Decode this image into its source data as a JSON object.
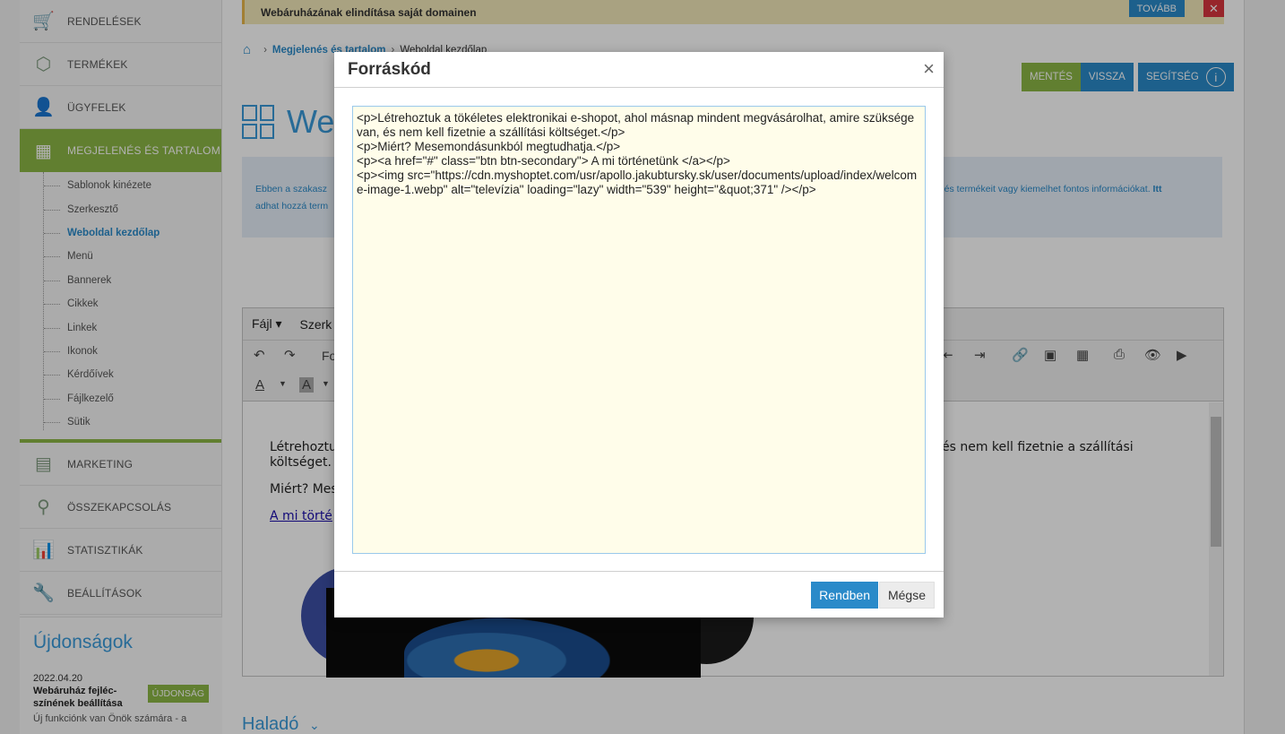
{
  "sidebar": {
    "items": [
      {
        "label": "RENDELÉSEK",
        "icon": "cart-icon"
      },
      {
        "label": "TERMÉKEK",
        "icon": "box-icon"
      },
      {
        "label": "ÜGYFELEK",
        "icon": "user-icon"
      },
      {
        "label": "MEGJELENÉS ÉS TARTALOM",
        "icon": "layout-icon"
      }
    ],
    "subitems": [
      "Sablonok kinézete",
      "Szerkesztő",
      "Weboldal kezdőlap",
      "Menü",
      "Bannerek",
      "Cikkek",
      "Linkek",
      "Ikonok",
      "Kérdőívek",
      "Fájlkezelő",
      "Sütik"
    ],
    "items_bottom": [
      {
        "label": "MARKETING",
        "icon": "megaphone-icon"
      },
      {
        "label": "ÖSSZEKAPCSOLÁS",
        "icon": "plug-icon"
      },
      {
        "label": "STATISZTIKÁK",
        "icon": "stats-icon"
      },
      {
        "label": "BEÁLLÍTÁSOK",
        "icon": "wrench-icon"
      }
    ]
  },
  "news": {
    "title": "Újdonságok",
    "date": "2022.04.20",
    "headline": "Webáruház fejléc-színének beállítása",
    "badge": "ÚJDONSÁG",
    "text": "Új funkciónk van Önök számára - a"
  },
  "notice": {
    "text": "Webáruházának elindítása saját domainen",
    "more": "TOVÁBB",
    "close": "✕"
  },
  "breadcrumb": {
    "link": "Megjelenés és tartalom",
    "current": "Weboldal kezdőlap"
  },
  "actions": {
    "save": "MENTÉS",
    "back": "VISSZA",
    "help": "SEGÍTSÉG"
  },
  "page": {
    "title_partial": "We",
    "info_left": "Ebben a szakasz",
    "info_left2": "adhat hozzá term",
    "info_right": "át és termékeit vagy kiemelhet fontos információkat.",
    "info_right_bold": "Itt"
  },
  "editor": {
    "menu": [
      "Fájl ▾",
      "Szerk"
    ],
    "format_partial": "Fo",
    "body_p1_left": "Létrehoztu",
    "body_p1_right": "és nem kell fizetnie a szállítási",
    "body_p1_line2": "költséget.",
    "body_p2": "Miért? Mes",
    "body_link": "A mi törté"
  },
  "advanced": {
    "label": "Haladó"
  },
  "modal": {
    "title": "Forráskód",
    "close": "×",
    "source": "<p>Létrehoztuk a tökéletes elektronikai e-shopot, ahol másnap mindent megvásárolhat, amire szüksége van, és nem kell fizetnie a szállítási költséget.</p>\n<p>Miért? Mesemondásunkból megtudhatja.</p>\n<p><a href=\"#\" class=\"btn btn-secondary\"> A mi történetünk </a></p>\n<p><img src=\"https://cdn.myshoptet.com/usr/apollo.jakubtursky.sk/user/documents/upload/index/welcome-image-1.webp\" alt=\"televízia\" loading=\"lazy\" width=\"539\" height=\"&quot;371\" /></p>",
    "ok": "Rendben",
    "cancel": "Mégse"
  }
}
